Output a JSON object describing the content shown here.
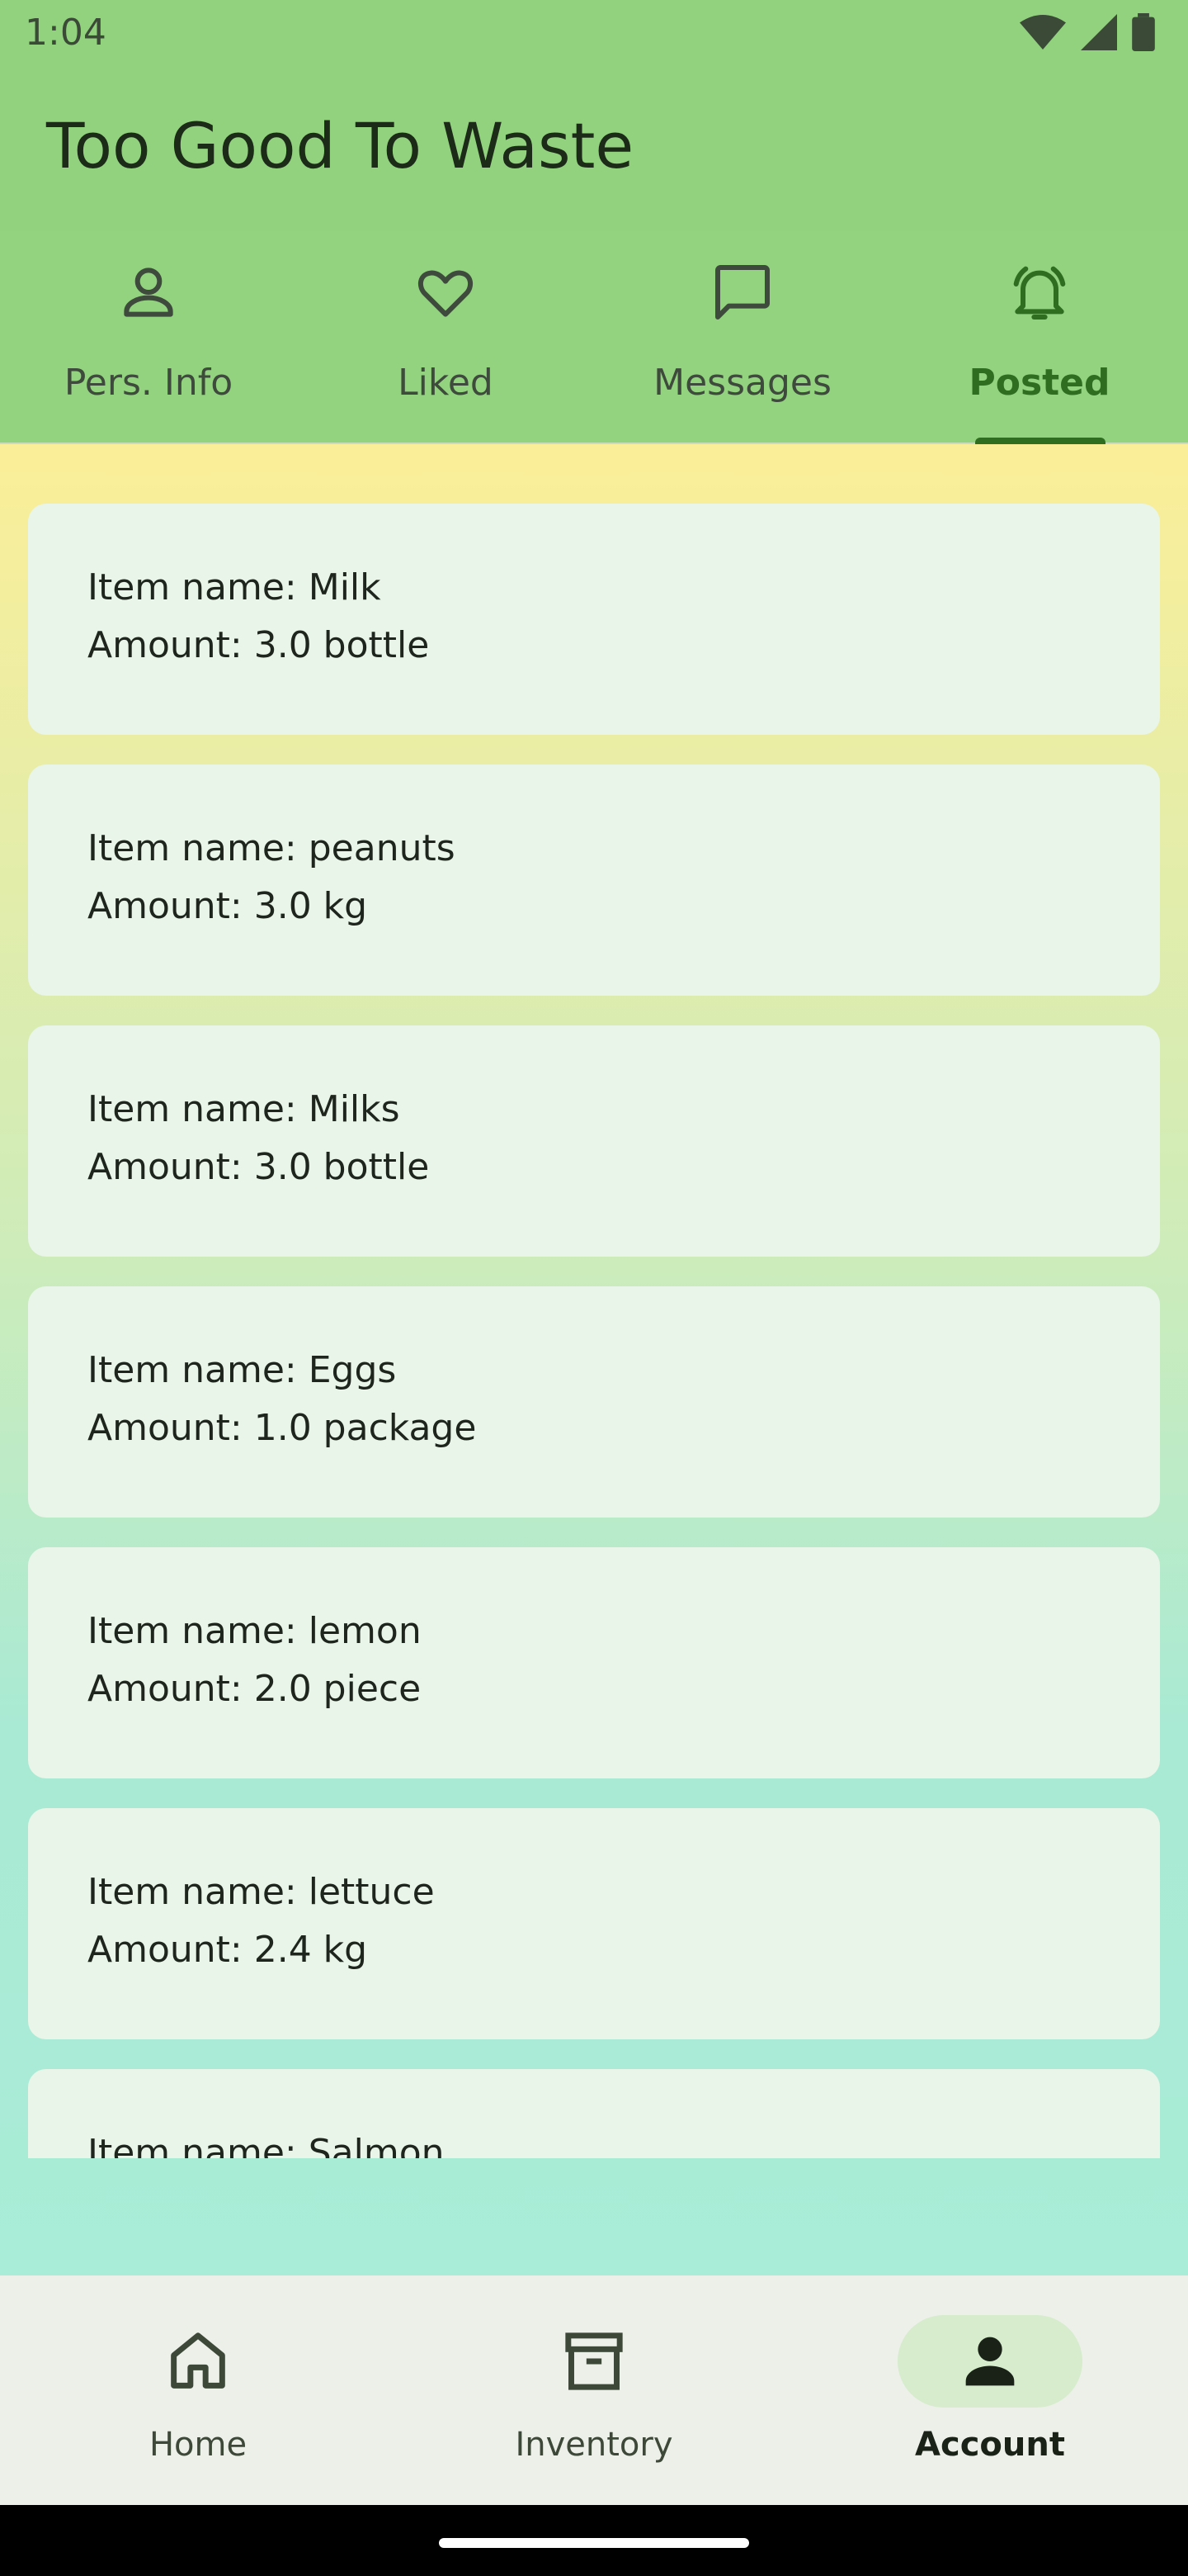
{
  "status_bar": {
    "time": "1:04"
  },
  "app": {
    "title": "Too Good To Waste"
  },
  "tabs": [
    {
      "label": "Pers. Info",
      "icon": "person-icon",
      "active": false
    },
    {
      "label": "Liked",
      "icon": "heart-icon",
      "active": false
    },
    {
      "label": "Messages",
      "icon": "message-icon",
      "active": false
    },
    {
      "label": "Posted",
      "icon": "bell-icon",
      "active": true
    }
  ],
  "items": [
    {
      "name": "Item name: Milk",
      "amount": "Amount: 3.0 bottle"
    },
    {
      "name": "Item name: peanuts",
      "amount": "Amount: 3.0 kg"
    },
    {
      "name": "Item name: Milks",
      "amount": "Amount: 3.0 bottle"
    },
    {
      "name": "Item name: Eggs",
      "amount": "Amount: 1.0 package"
    },
    {
      "name": "Item name: lemon",
      "amount": "Amount: 2.0 piece"
    },
    {
      "name": "Item name: lettuce",
      "amount": "Amount: 2.4 kg"
    },
    {
      "name": "Item name: Salmon",
      "amount": ""
    }
  ],
  "bottom_nav": [
    {
      "label": "Home",
      "icon": "home-icon",
      "active": false
    },
    {
      "label": "Inventory",
      "icon": "archive-box-icon",
      "active": false
    },
    {
      "label": "Account",
      "icon": "person-filled-icon",
      "active": true
    }
  ],
  "colors": {
    "appbar": "#92d27f",
    "active_tab": "#2f6d20",
    "card": "#e8f5e8",
    "nav_bg": "#ecf0e8",
    "nav_pill": "#d6eccd"
  }
}
